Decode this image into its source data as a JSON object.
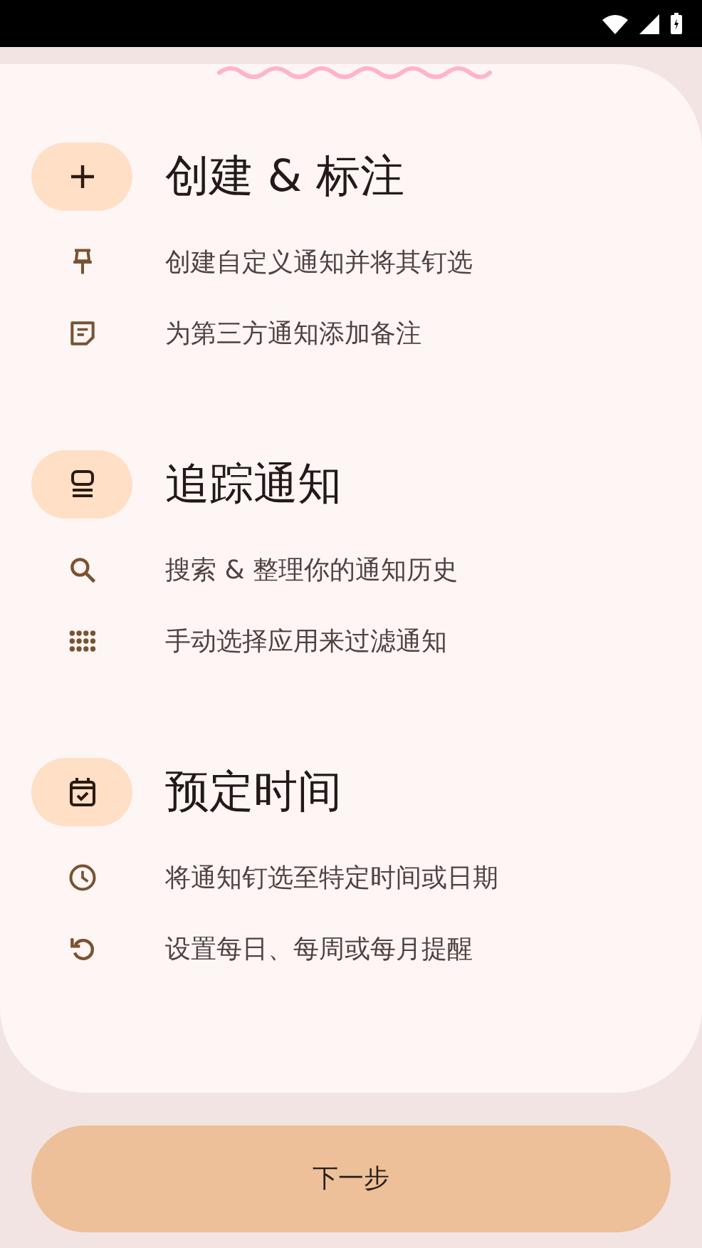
{
  "sections": [
    {
      "title": "创建 & 标注",
      "items": [
        {
          "text": "创建自定义通知并将其钉选"
        },
        {
          "text": "为第三方通知添加备注"
        }
      ]
    },
    {
      "title": "追踪通知",
      "items": [
        {
          "text": "搜索 & 整理你的通知历史"
        },
        {
          "text": "手动选择应用来过滤通知"
        }
      ]
    },
    {
      "title": "预定时间",
      "items": [
        {
          "text": "将通知钉选至特定时间或日期"
        },
        {
          "text": "设置每日、每周或每月提醒"
        }
      ]
    }
  ],
  "next_button": {
    "label": "下一步"
  }
}
